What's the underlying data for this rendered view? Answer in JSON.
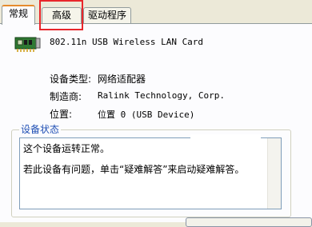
{
  "tabs": [
    {
      "label": "常规",
      "active": true
    },
    {
      "label": "高级",
      "active": false
    },
    {
      "label": "驱动程序",
      "active": false
    }
  ],
  "device": {
    "icon": "network-card-icon",
    "name": "802.11n USB Wireless LAN Card"
  },
  "properties": [
    {
      "label": "设备类型:",
      "value": "网络适配器"
    },
    {
      "label": "制造商:",
      "value": "Ralink Technology, Corp."
    },
    {
      "label": "位置:",
      "value": "位置 0 (USB Device)"
    }
  ],
  "status_group": {
    "title": "设备状态",
    "lines": [
      "这个设备运转正常。",
      "若此设备有问题，单击“疑难解答”来启动疑难解答。"
    ]
  },
  "colors": {
    "accent": "#e68b2c",
    "highlight": "#e8262b",
    "group_title": "#1f4fb4"
  }
}
